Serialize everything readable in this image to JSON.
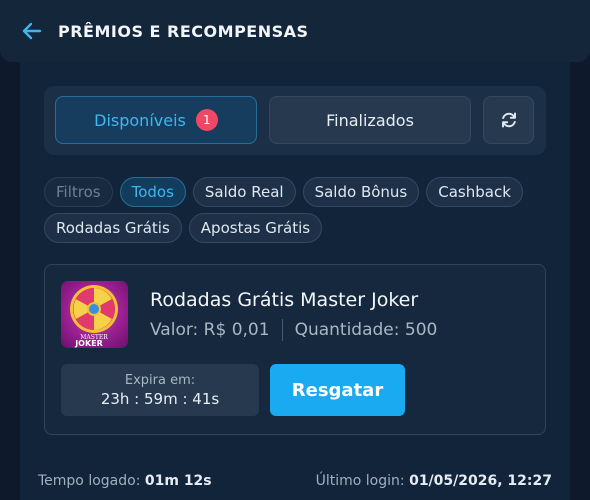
{
  "header": {
    "back_icon": "arrow-left-icon",
    "title": "PRÊMIOS E RECOMPENSAS"
  },
  "tabs": {
    "available": {
      "label": "Disponíveis",
      "badge": "1"
    },
    "finished": {
      "label": "Finalizados"
    },
    "refresh_icon": "refresh-icon"
  },
  "filters": {
    "label": "Filtros",
    "chips": [
      "Todos",
      "Saldo Real",
      "Saldo Bônus",
      "Cashback",
      "Rodadas Grátis",
      "Apostas Grátis"
    ],
    "active": "Todos"
  },
  "reward": {
    "image_text_line1": "MASTER",
    "image_text_line2": "JOKER",
    "title": "Rodadas Grátis Master Joker",
    "value": "Valor: R$ 0,01",
    "quantity": "Quantidade: 500",
    "expire_label": "Expira em:",
    "expire_time": "23h : 59m : 41s",
    "claim_label": "Resgatar"
  },
  "footer": {
    "session_label": "Tempo logado:",
    "session_value": "01m 12s",
    "last_login_label": "Último login:",
    "last_login_value": "01/05/2026, 12:27"
  },
  "colors": {
    "accent": "#19aaf1",
    "badge": "#f14766",
    "background": "#0e1a2b"
  }
}
